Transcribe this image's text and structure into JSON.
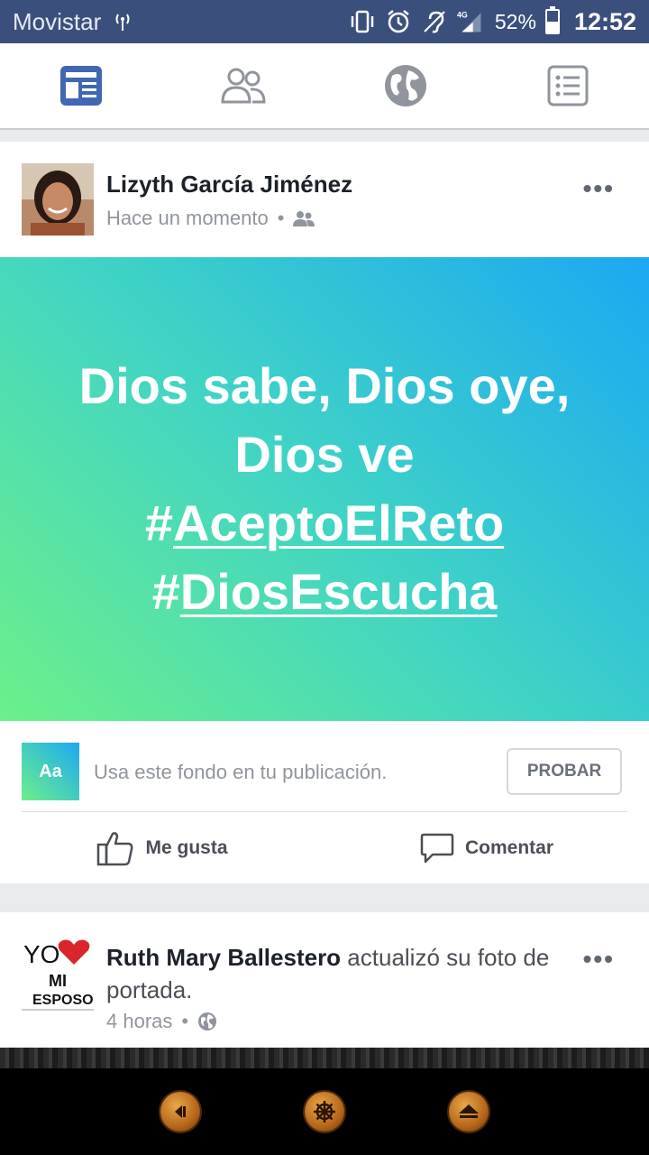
{
  "status_bar": {
    "carrier": "Movistar",
    "network": "4G",
    "battery_percent": "52%",
    "battery_level": 0.52,
    "time": "12:52"
  },
  "nav": {
    "items": [
      "news-feed",
      "friends",
      "notifications-globe",
      "menu"
    ],
    "active_color": "#4267b2",
    "inactive_color": "#90949c"
  },
  "post1": {
    "author": "Lizyth García Jiménez",
    "timestamp": "Hace un momento",
    "separator": "•",
    "audience_icon": "friends-icon",
    "lines": [
      "Dios sabe, Dios oye,",
      "Dios ve"
    ],
    "hashtags": [
      {
        "hash": "#",
        "tag": "AceptoElReto"
      },
      {
        "hash": "#",
        "tag": "DiosEscucha"
      }
    ],
    "try_background": {
      "icon_label": "Aa",
      "text": "Usa este fondo en tu publicación.",
      "button": "PROBAR"
    },
    "actions": {
      "like": "Me gusta",
      "comment": "Comentar"
    }
  },
  "post2": {
    "author": "Ruth Mary Ballestero",
    "action_text": " actualizó su foto de portada.",
    "timestamp": "4 horas",
    "separator": "•",
    "audience_icon": "globe-icon",
    "avatar_text": {
      "line1": "YO",
      "line2": "MI",
      "line3": "ESPOSO"
    }
  },
  "more_label": "•••",
  "colors": {
    "status_bar": "#3b4f7c",
    "gradient_start": "#6cf08a",
    "gradient_end": "#1ca8f2"
  }
}
